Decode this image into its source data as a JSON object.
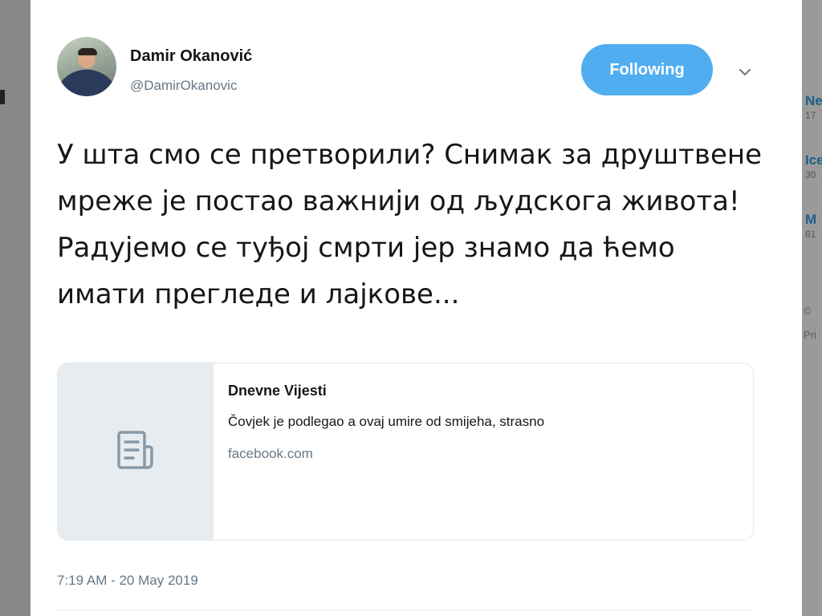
{
  "tweet": {
    "author_name": "Damir Okanović",
    "author_handle": "@DamirOkanovic",
    "follow_label": "Following",
    "text": "У шта смо се претворили? Снимак за друштвене мреже је постао важнији од људскога живота! Радујемо се туђој смрти јер знамо да ћемо имати прегледе и лајкове...",
    "timestamp": "7:19 AM - 20 May 2019",
    "icons": {
      "menu": "chevron-down-icon",
      "card_thumb": "document-icon"
    },
    "card": {
      "title": "Dnevne Vijesti",
      "description": "Čovjek je podlegao a ovaj umire od smijeha, strasno",
      "domain": "facebook.com"
    }
  },
  "background": {
    "trends": [
      {
        "title": "Ne",
        "count": "17"
      },
      {
        "title": "Ice",
        "count": "30"
      },
      {
        "title": "M",
        "count": "61"
      }
    ],
    "footer": [
      "©",
      "Pri"
    ]
  },
  "colors": {
    "accent": "#50aef0",
    "secondary_text": "#657786",
    "primary_text": "#14171a"
  }
}
